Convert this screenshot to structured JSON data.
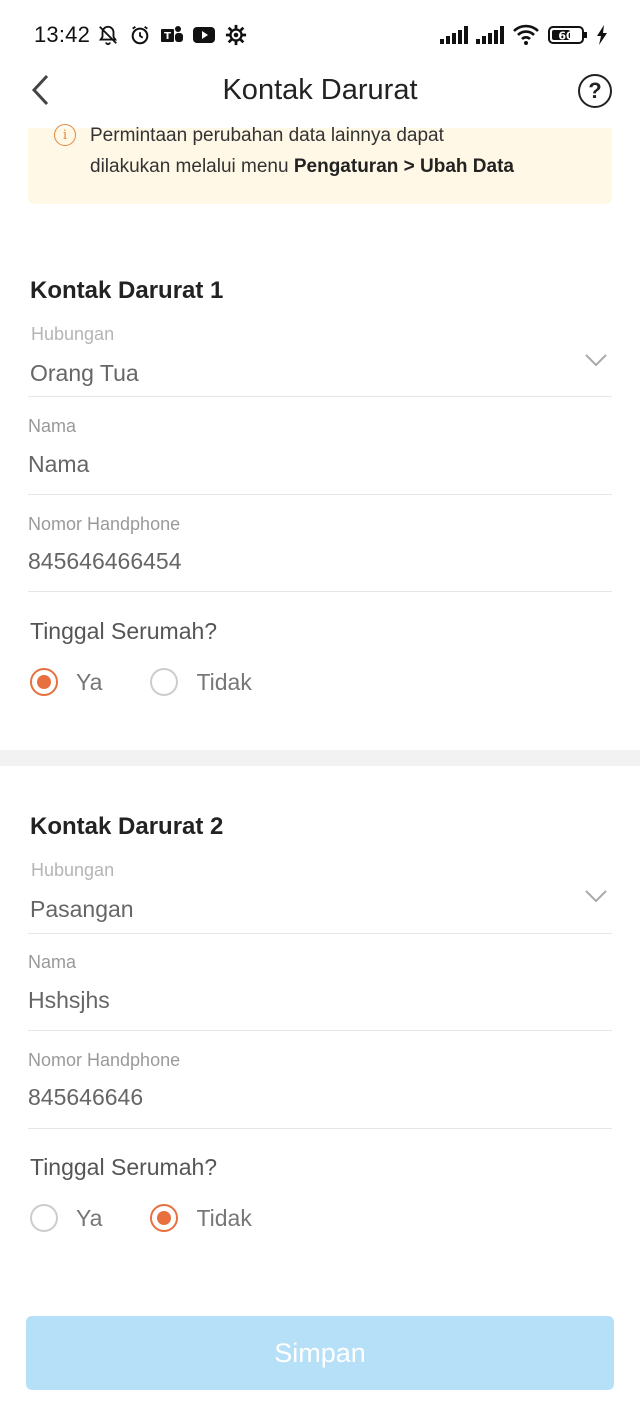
{
  "status_bar": {
    "time": "13:42",
    "icons_left": [
      "mute-notification-icon",
      "alarm-icon",
      "teams-icon",
      "youtube-icon",
      "settings-gear-icon"
    ],
    "icons_right": [
      "signal-icon",
      "signal-icon",
      "wifi-icon",
      "battery-icon",
      "charging-icon"
    ],
    "battery_level": "60"
  },
  "header": {
    "title": "Kontak Darurat",
    "back_icon": "chevron-left-icon",
    "help_label": "?"
  },
  "info_banner": {
    "icon_glyph": "i",
    "text_line1": "Permintaan perubahan data lainnya dapat",
    "text_line2_prefix": "dilakukan melalui menu ",
    "text_line2_bold": "Pengaturan > Ubah Data",
    "icon_color": "#e0883a",
    "background": "#fff8e6"
  },
  "contacts": [
    {
      "title": "Kontak Darurat 1",
      "relation_label": "Hubungan",
      "relation_value": "Orang Tua",
      "name_label": "Nama",
      "name_value": "Nama",
      "phone_label": "Nomor Handphone",
      "phone_value": "845646466454",
      "question": "Tinggal Serumah?",
      "option_yes": "Ya",
      "option_no": "Tidak",
      "selected": "Ya"
    },
    {
      "title": "Kontak Darurat 2",
      "relation_label": "Hubungan",
      "relation_value": "Pasangan",
      "name_label": "Nama",
      "name_value": "Hshsjhs",
      "phone_label": "Nomor Handphone",
      "phone_value": "845646646",
      "question": "Tinggal Serumah?",
      "option_yes": "Ya",
      "option_no": "Tidak",
      "selected": "Tidak"
    }
  ],
  "save_button": {
    "label": "Simpan",
    "disabled": true
  },
  "colors": {
    "accent": "#e8703f",
    "button_disabled_bg": "#b5e0f8",
    "divider_band": "#f2f2f2"
  }
}
